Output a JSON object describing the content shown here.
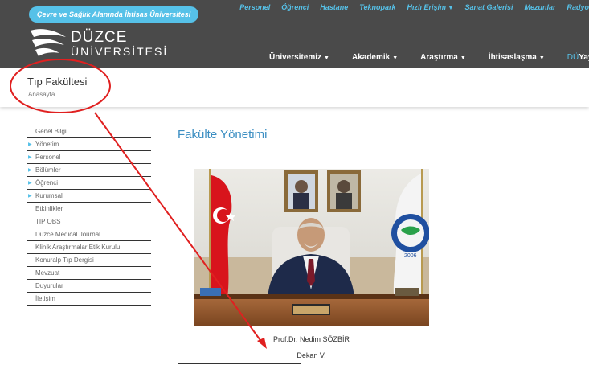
{
  "header": {
    "pill": "Çevre ve Sağlık Alanında İhtisas Üniversitesi",
    "topnav": [
      "Personel",
      "Öğrenci",
      "Hastane",
      "Teknopark",
      "Hızlı Erişim",
      "Sanat Galerisi",
      "Mezunlar",
      "Radyo"
    ],
    "logo_line1": "DÜZCE",
    "logo_line2": "ÜNİVERSİTESİ",
    "mainnav": [
      "Üniversitemiz",
      "Akademik",
      "Araştırma",
      "İhtisaslaşma"
    ],
    "du_prefix": "DÜ",
    "du_suffix": "Yayınlar"
  },
  "band": {
    "title": "Tıp Fakültesi",
    "breadcrumb": "Anasayfa"
  },
  "sidebar": [
    {
      "label": "Genel Bilgi",
      "arrow": false
    },
    {
      "label": "Yönetim",
      "arrow": true
    },
    {
      "label": "Personel",
      "arrow": true
    },
    {
      "label": "Bölümler",
      "arrow": true
    },
    {
      "label": "Öğrenci",
      "arrow": true
    },
    {
      "label": "Kurumsal",
      "arrow": true
    },
    {
      "label": "Etkinlikler",
      "arrow": false
    },
    {
      "label": "TIP OBS",
      "arrow": false
    },
    {
      "label": "Duzce Medical Journal",
      "arrow": false
    },
    {
      "label": "Klinik Araştırmalar Etik Kurulu",
      "arrow": false
    },
    {
      "label": "Konuralp Tıp Dergisi",
      "arrow": false
    },
    {
      "label": "Mevzuat",
      "arrow": false
    },
    {
      "label": "Duyurular",
      "arrow": false
    },
    {
      "label": "İletişim",
      "arrow": false
    }
  ],
  "content": {
    "title": "Fakülte Yönetimi",
    "person_name": "Prof.Dr. Nedim SÖZBİR",
    "person_role": "Dekan V.",
    "flag_badge_year": "2006"
  },
  "colors": {
    "header_bg": "#4a4a4a",
    "accent": "#56c1e8",
    "title_blue": "#3b8ec2",
    "annotation_red": "#e02020"
  }
}
